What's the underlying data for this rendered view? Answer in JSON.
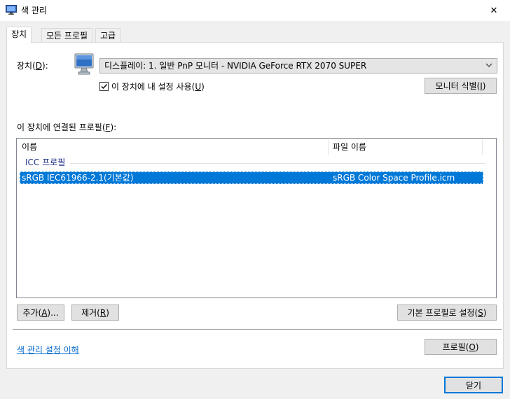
{
  "window": {
    "title": "색 관리",
    "close_glyph": "✕"
  },
  "tabs": [
    {
      "label": "장치",
      "active": true
    },
    {
      "label": "모든 프로필",
      "active": false
    },
    {
      "label": "고급",
      "active": false
    }
  ],
  "device": {
    "label_prefix": "장치(",
    "label_key": "D",
    "label_suffix": "):",
    "combo_value": "디스플레이: 1. 일반 PnP 모니터 - NVIDIA GeForce RTX 2070 SUPER",
    "checkbox_checked": true,
    "checkbox_label_prefix": "이 장치에 내 설정 사용(",
    "checkbox_label_key": "U",
    "checkbox_label_suffix": ")",
    "identify_prefix": "모니터 식별(",
    "identify_key": "I",
    "identify_suffix": ")"
  },
  "profiles": {
    "section_label_prefix": "이 장치에 연결된 프로필(",
    "section_label_key": "F",
    "section_label_suffix": "):",
    "columns": [
      "이름",
      "파일 이름"
    ],
    "group_label": "ICC 프로필",
    "rows": [
      {
        "name": "sRGB IEC61966-2.1(기본값)",
        "file": "sRGB Color Space Profile.icm",
        "selected": true
      }
    ]
  },
  "buttons": {
    "add_prefix": "추가(",
    "add_key": "A",
    "add_suffix": ")...",
    "remove_prefix": "제거(",
    "remove_key": "R",
    "remove_suffix": ")",
    "set_default_prefix": "기본 프로필로 설정(",
    "set_default_key": "S",
    "set_default_suffix": ")",
    "profile_prefix": "프로필(",
    "profile_key": "O",
    "profile_suffix": ")",
    "close": "닫기"
  },
  "link": "색 관리 설정 이해",
  "colors": {
    "accent": "#0078d7",
    "selection": "#0078d7",
    "link": "#0066cc",
    "group": "#1e3287"
  }
}
